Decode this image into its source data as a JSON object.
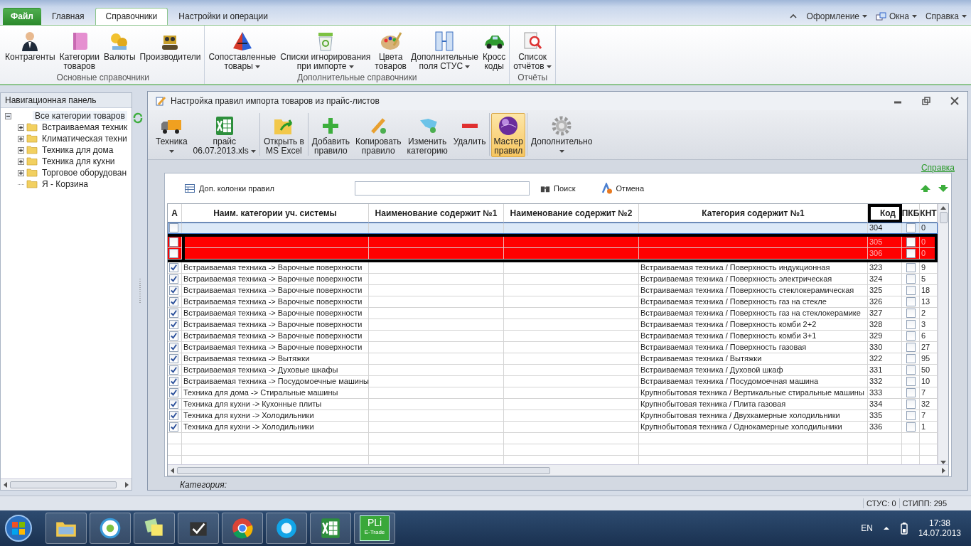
{
  "menu_tabs": [
    {
      "label": "Файл",
      "kind": "file",
      "selected": false
    },
    {
      "label": "Главная",
      "kind": "tab",
      "selected": false
    },
    {
      "label": "Справочники",
      "kind": "tab",
      "selected": true
    },
    {
      "label": "Настройки и операции",
      "kind": "tab",
      "selected": false
    }
  ],
  "top_menus": [
    {
      "label": "Оформление"
    },
    {
      "label": "Окна"
    },
    {
      "label": "Справка"
    }
  ],
  "ribbon_groups": [
    {
      "title": "Основные справочники",
      "buttons": [
        {
          "label": "Контрагенты",
          "dropdown": false
        },
        {
          "label": "Категории\nтоваров",
          "dropdown": false
        },
        {
          "label": "Валюты",
          "dropdown": false
        },
        {
          "label": "Производители",
          "dropdown": false
        }
      ]
    },
    {
      "title": "Дополнительные справочники",
      "buttons": [
        {
          "label": "Сопоставленные\nтовары",
          "dropdown": true
        },
        {
          "label": "Списки игнорирования\nпри импорте",
          "dropdown": true
        },
        {
          "label": "Цвета\nтоваров",
          "dropdown": false
        },
        {
          "label": "Дополнительные\nполя СТУС",
          "dropdown": true
        },
        {
          "label": "Кросс\nкоды",
          "dropdown": false
        }
      ]
    },
    {
      "title": "Отчёты",
      "buttons": [
        {
          "label": "Список\nотчётов",
          "dropdown": true
        }
      ]
    }
  ],
  "nav_panel": {
    "title": "Навигационная панель",
    "tree": [
      {
        "label": "Все категории товаров",
        "expanded": true,
        "selected": true,
        "children": [
          {
            "label": "Встраиваемая техник",
            "expanded": false,
            "selected": false
          },
          {
            "label": "Климатическая техни",
            "expanded": false,
            "selected": false
          },
          {
            "label": "Техника для дома",
            "expanded": false,
            "selected": false
          },
          {
            "label": "Техника для кухни",
            "expanded": false,
            "selected": false
          },
          {
            "label": "Торговое оборудован",
            "expanded": false,
            "selected": false
          },
          {
            "label": "Я - Корзина",
            "selected": false
          }
        ]
      }
    ]
  },
  "child_window": {
    "title": "Настройка правил импорта товаров из прайс-листов",
    "toolbar": [
      {
        "label": "Техника",
        "dropdown": true,
        "active": false
      },
      {
        "label": "прайс\n06.07.2013.xls",
        "dropdown": true,
        "active": false
      },
      {
        "label": "Открыть в\nMS Excel",
        "dropdown": false,
        "active": false
      },
      {
        "label": "Добавить\nправило",
        "dropdown": false,
        "active": false
      },
      {
        "label": "Копировать\nправило",
        "dropdown": false,
        "active": false
      },
      {
        "label": "Изменить\nкатегорию",
        "dropdown": false,
        "active": false
      },
      {
        "label": "Удалить",
        "dropdown": false,
        "active": false
      },
      {
        "label": "Мастер\nправил",
        "dropdown": false,
        "active": true
      },
      {
        "label": "Дополнительно",
        "dropdown": true,
        "active": false
      }
    ],
    "help_link": "Справка",
    "columns_button": "Доп. колонки правил",
    "search_button": "Поиск",
    "cancel_button": "Отмена",
    "table": {
      "columns": [
        {
          "label": "А",
          "framed": false
        },
        {
          "label": "Наим. категории уч. системы",
          "framed": false
        },
        {
          "label": "Наименование содержит №1",
          "framed": false
        },
        {
          "label": "Наименование содержит №2",
          "framed": false
        },
        {
          "label": "Категория содержит №1",
          "framed": false
        },
        {
          "label": "Код",
          "framed": true
        },
        {
          "label": "ПКБ",
          "framed": false
        },
        {
          "label": "КНТ",
          "framed": false
        }
      ],
      "rows": [
        {
          "checked": false,
          "code": "304",
          "pkb": false,
          "count": "0",
          "selected": true,
          "error": false,
          "framed": false
        },
        {
          "checked": false,
          "code": "305",
          "pkb": false,
          "count": "0",
          "selected": false,
          "error": true,
          "framed": true
        },
        {
          "checked": false,
          "code": "306",
          "pkb": false,
          "count": "0",
          "selected": false,
          "error": true,
          "framed": true
        },
        {
          "checked": true,
          "category": "Встраиваемая техника -> Варочные поверхности",
          "target": "Встраиваемая техника / Поверхность индукционная",
          "code": "323",
          "pkb": false,
          "count": "9",
          "selected": false,
          "error": false,
          "framed": false
        },
        {
          "checked": true,
          "category": "Встраиваемая техника -> Варочные поверхности",
          "target": "Встраиваемая техника / Поверхность электрическая",
          "code": "324",
          "pkb": false,
          "count": "5",
          "selected": false,
          "error": false,
          "framed": false
        },
        {
          "checked": true,
          "category": "Встраиваемая техника -> Варочные поверхности",
          "target": "Встраиваемая техника / Поверхность стеклокерамическая",
          "code": "325",
          "pkb": false,
          "count": "18",
          "selected": false,
          "error": false,
          "framed": false
        },
        {
          "checked": true,
          "category": "Встраиваемая техника -> Варочные поверхности",
          "target": "Встраиваемая техника / Поверхность газ на стекле",
          "code": "326",
          "pkb": false,
          "count": "13",
          "selected": false,
          "error": false,
          "framed": false
        },
        {
          "checked": true,
          "category": "Встраиваемая техника -> Варочные поверхности",
          "target": "Встраиваемая техника / Поверхность газ на стеклокерамике",
          "code": "327",
          "pkb": false,
          "count": "2",
          "selected": false,
          "error": false,
          "framed": false
        },
        {
          "checked": true,
          "category": "Встраиваемая техника -> Варочные поверхности",
          "target": "Встраиваемая техника / Поверхность комби 2+2",
          "code": "328",
          "pkb": false,
          "count": "3",
          "selected": false,
          "error": false,
          "framed": false
        },
        {
          "checked": true,
          "category": "Встраиваемая техника -> Варочные поверхности",
          "target": "Встраиваемая техника / Поверхность комби 3+1",
          "code": "329",
          "pkb": false,
          "count": "6",
          "selected": false,
          "error": false,
          "framed": false
        },
        {
          "checked": true,
          "category": "Встраиваемая техника -> Варочные поверхности",
          "target": "Встраиваемая техника / Поверхность газовая",
          "code": "330",
          "pkb": false,
          "count": "27",
          "selected": false,
          "error": false,
          "framed": false
        },
        {
          "checked": true,
          "category": "Встраиваемая техника -> Вытяжки",
          "target": "Встраиваемая техника / Вытяжки",
          "code": "322",
          "pkb": false,
          "count": "95",
          "selected": false,
          "error": false,
          "framed": false
        },
        {
          "checked": true,
          "category": "Встраиваемая техника -> Духовые шкафы",
          "target": "Встраиваемая техника / Духовой шкаф",
          "code": "331",
          "pkb": false,
          "count": "50",
          "selected": false,
          "error": false,
          "framed": false
        },
        {
          "checked": true,
          "category": "Встраиваемая техника -> Посудомоечные машины",
          "target": "Встраиваемая техника / Посудомоечная машина",
          "code": "332",
          "pkb": false,
          "count": "10",
          "selected": false,
          "error": false,
          "framed": false
        },
        {
          "checked": true,
          "category": "Техника для дома -> Стиральные машины",
          "target": "Крупнобытовая техника / Вертикальные стиральные машины",
          "code": "333",
          "pkb": false,
          "count": "7",
          "selected": false,
          "error": false,
          "framed": false
        },
        {
          "checked": true,
          "category": "Техника для кухни -> Кухонные плиты",
          "target": "Крупнобытовая техника / Плита газовая",
          "code": "334",
          "pkb": false,
          "count": "32",
          "selected": false,
          "error": false,
          "framed": false
        },
        {
          "checked": true,
          "category": "Техника для кухни -> Холодильники",
          "target": "Крупнобытовая техника / Двухкамерные холодильники",
          "code": "335",
          "pkb": false,
          "count": "7",
          "selected": false,
          "error": false,
          "framed": false
        },
        {
          "checked": true,
          "category": "Техника для кухни -> Холодильники",
          "target": "Крупнобытовая техника / Однокамерные холодильники",
          "code": "336",
          "pkb": false,
          "count": "1",
          "selected": false,
          "error": false,
          "framed": false
        }
      ]
    },
    "footer_label": "Категория:"
  },
  "status_bar": [
    "СТУС: 0",
    "СТИПП: 295"
  ],
  "taskbar": {
    "app_label": "PLi",
    "app_sublabel": "E-Trade",
    "language": "EN",
    "time": "17:38",
    "date": "14.07.2013"
  }
}
